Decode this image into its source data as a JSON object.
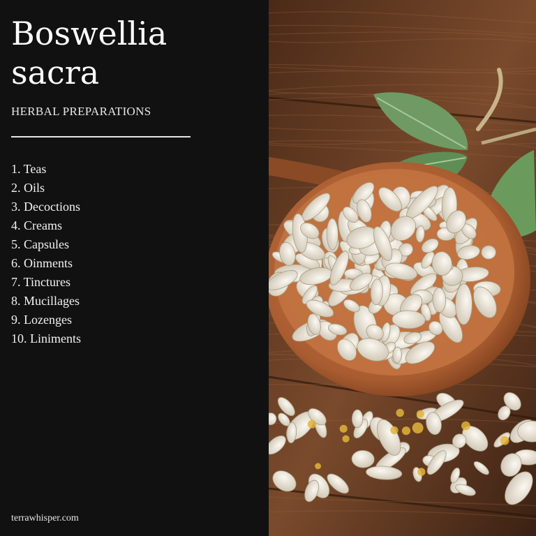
{
  "title_line1": "Boswellia",
  "title_line2": "sacra",
  "subtitle": "HERBAL PREPARATIONS",
  "preparations": [
    "1. Teas",
    "2. Oils",
    "3. Decoctions",
    "4. Creams",
    "5. Capsules",
    "6. Oinments",
    "7. Tinctures",
    "8. Mucillages",
    "9. Lozenges",
    "10. Liniments"
  ],
  "footer": "terrawhisper.com",
  "colors": {
    "panel": "#111111",
    "wood": "#6b3d22",
    "bowl": "#b5683a",
    "resin": "#ece7dc",
    "leaf": "#6f9a63"
  }
}
